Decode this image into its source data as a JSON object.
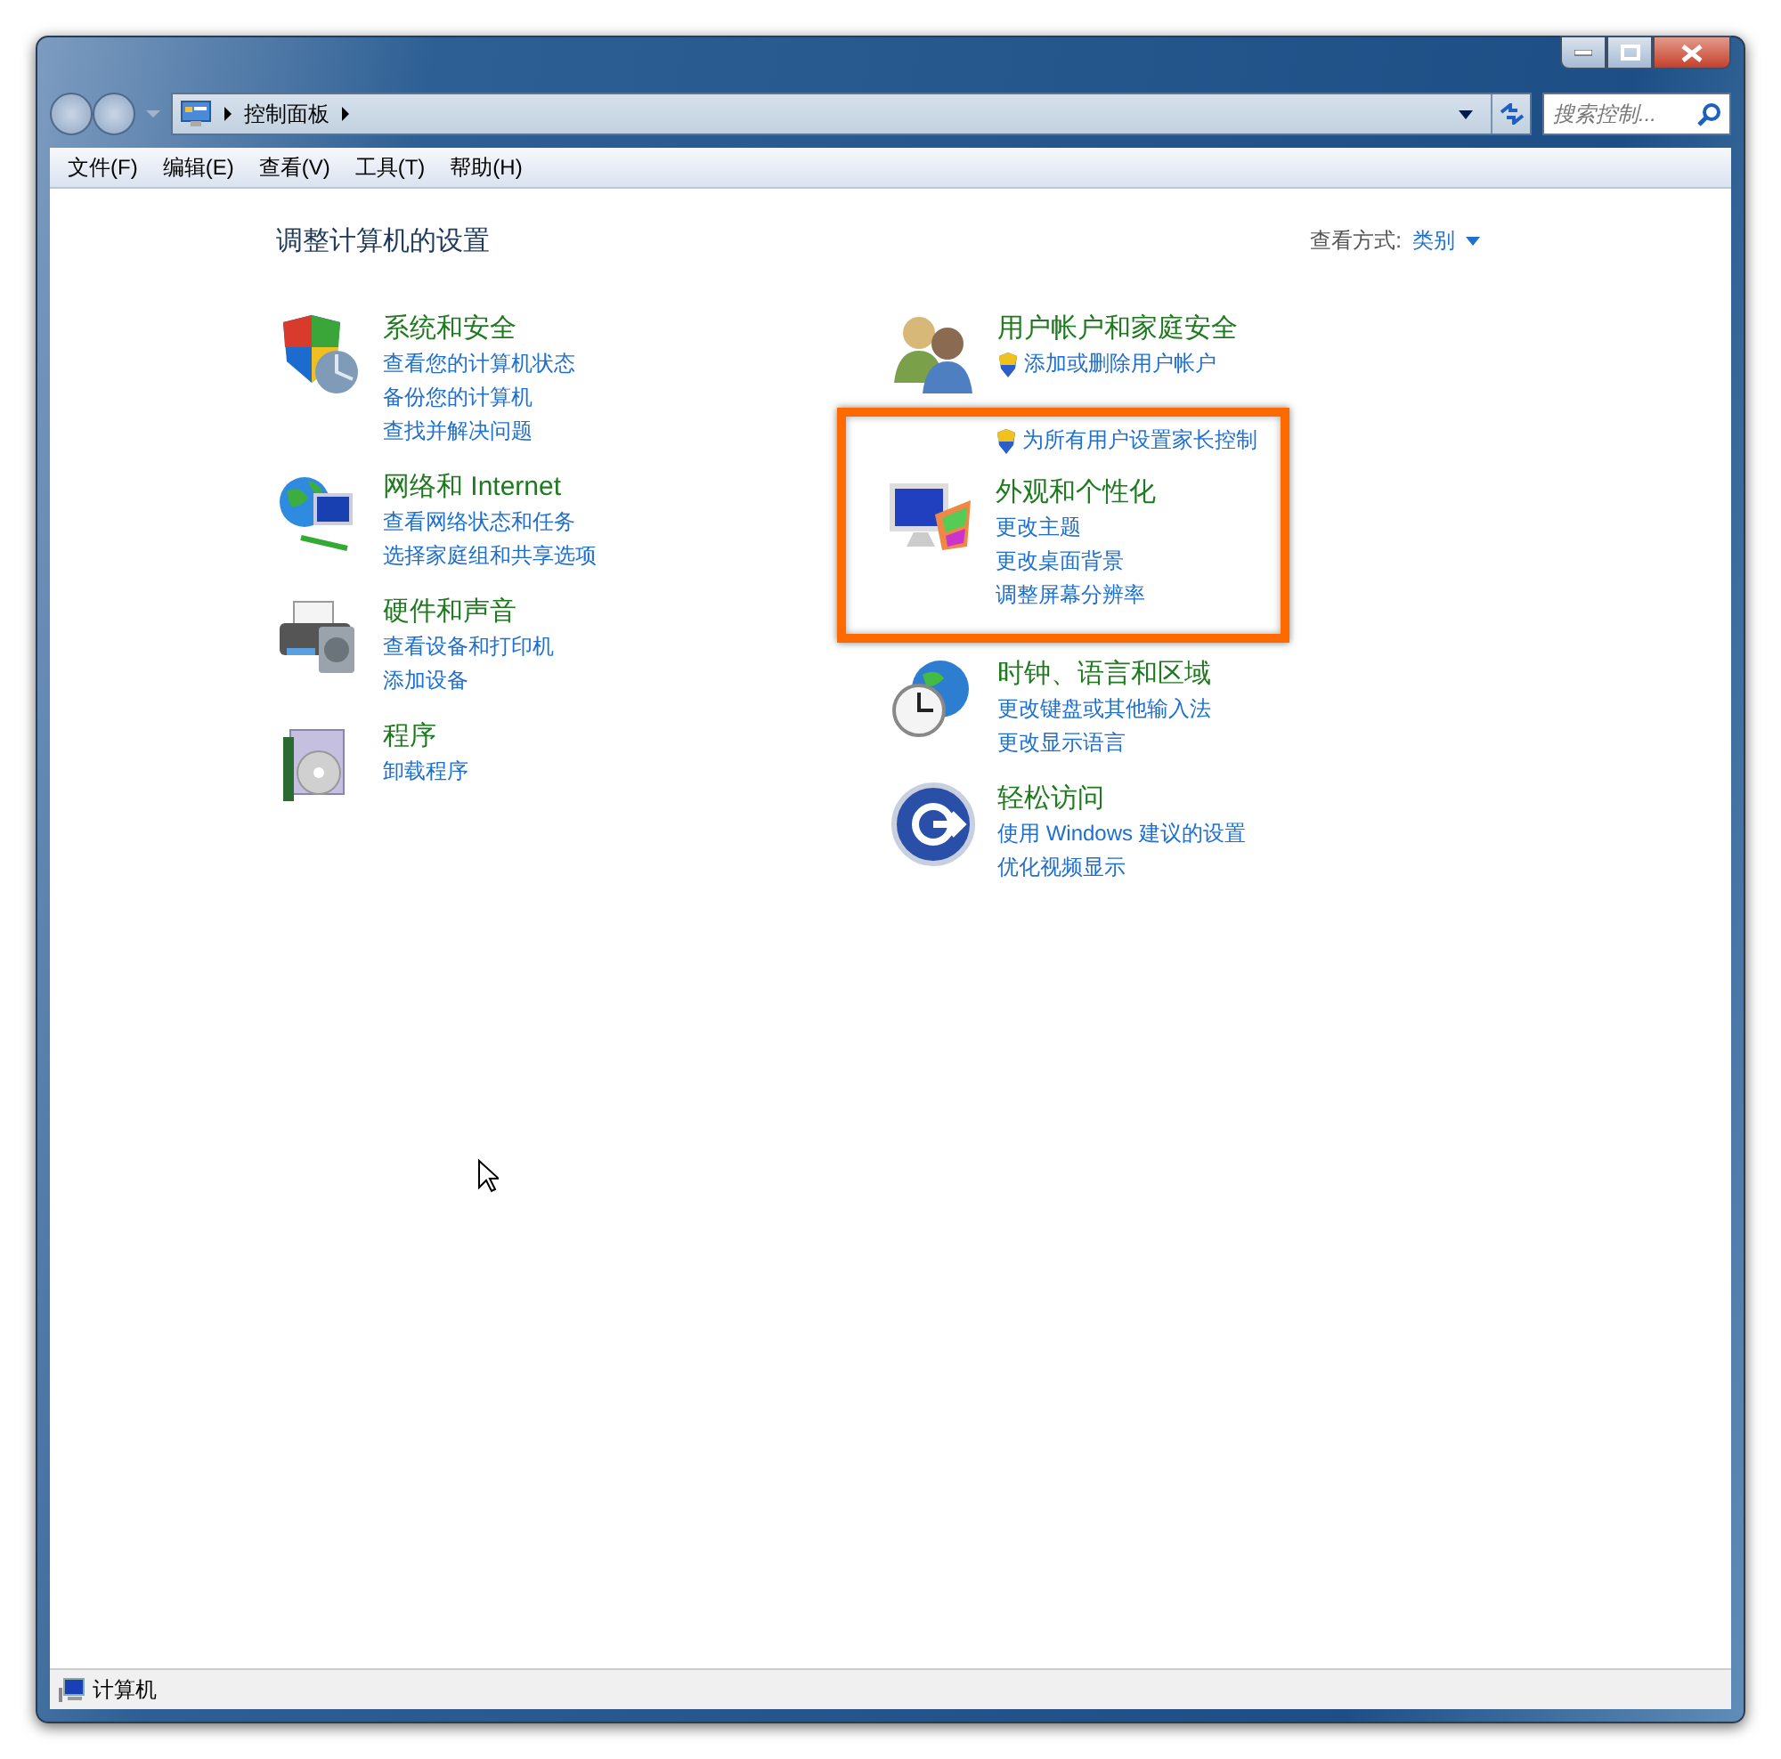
{
  "address_bar": {
    "path": [
      "控制面板"
    ]
  },
  "search": {
    "placeholder": "搜索控制..."
  },
  "menu": [
    "文件(F)",
    "编辑(E)",
    "查看(V)",
    "工具(T)",
    "帮助(H)"
  ],
  "heading": "调整计算机的设置",
  "view_by": {
    "label": "查看方式:",
    "value": "类别"
  },
  "columns": [
    [
      {
        "title": "系统和安全",
        "links": [
          {
            "text": "查看您的计算机状态",
            "kind": "plain"
          },
          {
            "text": "备份您的计算机",
            "kind": "plain"
          },
          {
            "text": "查找并解决问题",
            "kind": "plain"
          }
        ]
      },
      {
        "title": "网络和 Internet",
        "links": [
          {
            "text": "查看网络状态和任务",
            "kind": "plain"
          },
          {
            "text": "选择家庭组和共享选项",
            "kind": "plain"
          }
        ]
      },
      {
        "title": "硬件和声音",
        "links": [
          {
            "text": "查看设备和打印机",
            "kind": "plain"
          },
          {
            "text": "添加设备",
            "kind": "plain"
          }
        ]
      },
      {
        "title": "程序",
        "links": [
          {
            "text": "卸载程序",
            "kind": "plain"
          }
        ]
      }
    ],
    [
      {
        "title": "用户帐户和家庭安全",
        "highlighted": false,
        "links": [
          {
            "text": "添加或删除用户帐户",
            "kind": "shield",
            "highlighted": false
          },
          {
            "text": "为所有用户设置家长控制",
            "kind": "shield",
            "highlighted": true
          }
        ]
      },
      {
        "title": "外观和个性化",
        "highlighted": true,
        "links": [
          {
            "text": "更改主题",
            "kind": "plain"
          },
          {
            "text": "更改桌面背景",
            "kind": "plain"
          },
          {
            "text": "调整屏幕分辨率",
            "kind": "plain"
          }
        ]
      },
      {
        "title": "时钟、语言和区域",
        "highlighted": false,
        "links": [
          {
            "text": "更改键盘或其他输入法",
            "kind": "plain"
          },
          {
            "text": "更改显示语言",
            "kind": "plain"
          }
        ]
      },
      {
        "title": "轻松访问",
        "highlighted": false,
        "links": [
          {
            "text": "使用 Windows 建议的设置",
            "kind": "plain"
          },
          {
            "text": "优化视频显示",
            "kind": "plain"
          }
        ]
      }
    ]
  ],
  "status_bar": {
    "text": "计算机"
  }
}
